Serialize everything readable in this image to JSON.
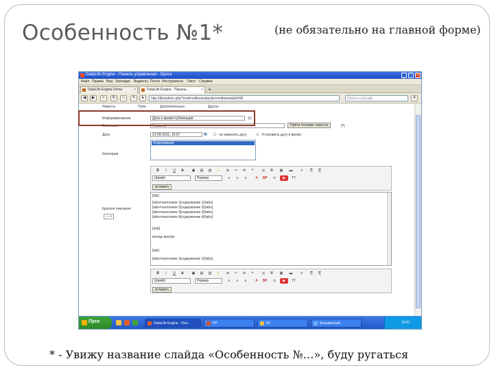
{
  "slide": {
    "title": "Особенность №1*",
    "subtitle": "(не обязательно на главной форме)",
    "footnote": "* - Увижу название слайда «Особенность №…», буду ругаться"
  },
  "browser": {
    "window_title": "DataLife Engine - Панель управления - Opera",
    "menu": [
      "Файл",
      "Правка",
      "Вид",
      "Закладки",
      "Виджеты",
      "Почта",
      "Инструменты",
      "Окно",
      "Справка"
    ],
    "tabs": [
      "DataLife Engine Demo",
      "DataLife Engine - Панель..."
    ],
    "url": "http://dle/admin.php?mod=editnews&action=editnews&id=68",
    "search_placeholder": "Искать в Google"
  },
  "form": {
    "row0": [
      "Новость",
      "Поле",
      "Дополнительно",
      "Другое"
    ],
    "info_label": "Информирование",
    "info_value": "Дата и время публикации",
    "title_label": "Заголовок",
    "title_value": "Новость",
    "check_button": "Найти похожие новости",
    "date_label": "Дата",
    "date_value": "21-09-2011, 15:57",
    "date_check": "не изменять дату",
    "date_check2": "Установить дату и время",
    "list_item": "Информация",
    "category_label": "Категория",
    "font_select": "Шрифт",
    "size_select": "Размер",
    "more_button": "вставить",
    "short_label": "Краткое описание",
    "stepper": "—  +",
    "code_lines": [
      "[tab]",
      "[tabs=заголовок 1]содержание 1[/tabs]",
      "[tabs=заголовок 2]содержание 2[/tabs]",
      "[tabs=заголовок 3]содержание 3[/tabs]",
      "[tabs=заголовок 4]содержание 4[/tabs]",
      "",
      "[/tab]",
      "всегда внутри",
      "",
      "[tab]",
      "[tabs=заголовок 1]содержание 1[/tabs]"
    ]
  },
  "taskbar": {
    "start_label": "Пуск",
    "tasks": [
      "DataLife Engine - Опе...",
      "PP",
      "EF",
      "Безымянный"
    ],
    "tray_time": "15:57"
  },
  "colors": {
    "highlight_border": "#8b3a2a",
    "title_gray": "#5a5a5a"
  }
}
